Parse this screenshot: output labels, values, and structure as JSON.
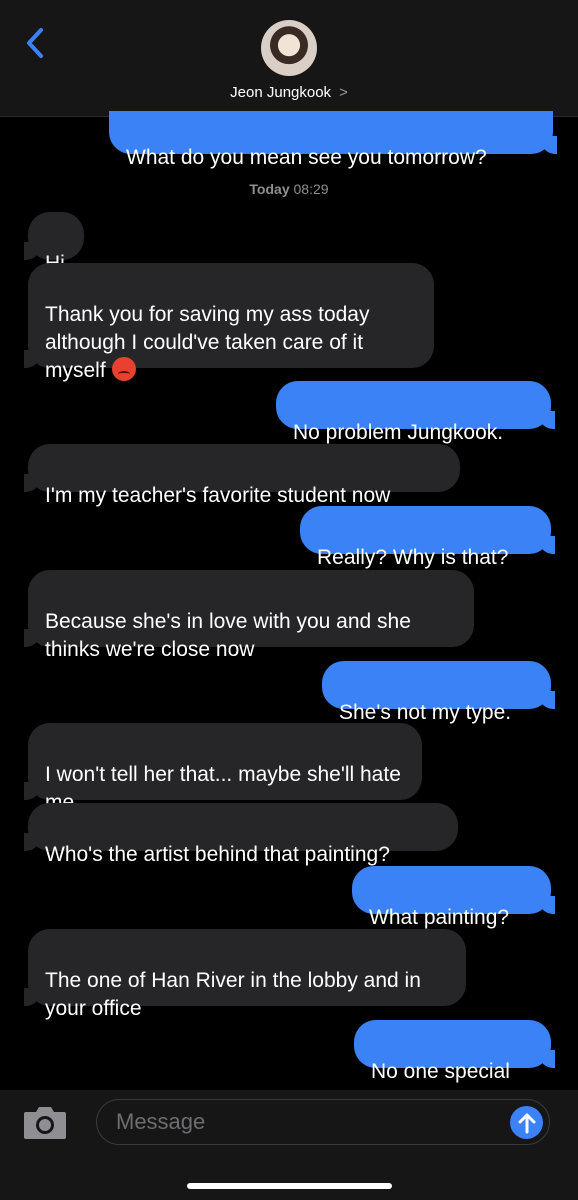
{
  "header": {
    "contact_name": "Jeon Jungkook",
    "chevron": ">"
  },
  "timestamp": {
    "day": "Today",
    "time": "08:29"
  },
  "messages": [
    {
      "dir": "out",
      "text": "What do you mean see you tomorrow?"
    },
    {
      "dir": "in",
      "text": "Hi"
    },
    {
      "dir": "in",
      "text": "Thank you for saving my ass today although I could've taken care of it myself",
      "emoji": "angry-face"
    },
    {
      "dir": "out",
      "text": "No problem Jungkook."
    },
    {
      "dir": "in",
      "text": "I'm my teacher's favorite student now"
    },
    {
      "dir": "out",
      "text": "Really? Why is that?"
    },
    {
      "dir": "in",
      "text": "Because she's in love with you and she thinks we're close now"
    },
    {
      "dir": "out",
      "text": "She's not my type."
    },
    {
      "dir": "in",
      "text": "I won't tell her that... maybe she'll hate me"
    },
    {
      "dir": "in",
      "text": "Who's the artist behind that painting?"
    },
    {
      "dir": "out",
      "text": "What painting?"
    },
    {
      "dir": "in",
      "text": "The one of Han River in the lobby and in your office"
    },
    {
      "dir": "out",
      "text": "No one special"
    }
  ],
  "composer": {
    "placeholder": "Message",
    "value": ""
  },
  "colors": {
    "outgoing": "#3b82f6",
    "incoming": "#262629",
    "background": "#000000"
  }
}
